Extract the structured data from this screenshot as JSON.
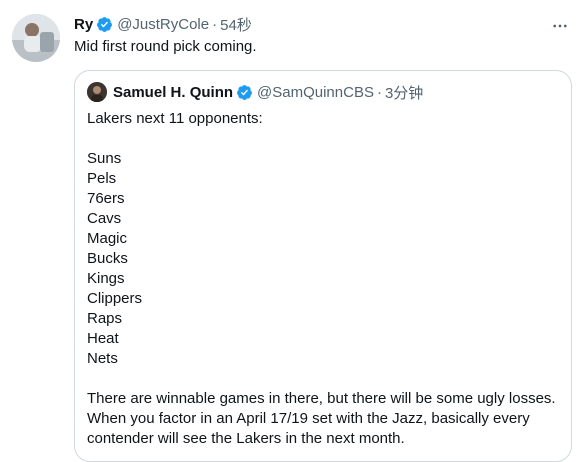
{
  "tweet": {
    "author_name": "Ry",
    "author_handle": "@JustRyCole",
    "separator": "·",
    "time": "54秒",
    "text": "Mid first round pick coming."
  },
  "quote": {
    "author_name": "Samuel H. Quinn",
    "author_handle": "@SamQuinnCBS",
    "separator": "·",
    "time": "3分钟",
    "intro": "Lakers next 11 opponents:",
    "teams": [
      "Suns",
      "Pels",
      "76ers",
      "Cavs",
      "Magic",
      "Bucks",
      "Kings",
      "Clippers",
      "Raps",
      "Heat",
      "Nets"
    ],
    "closing": "There are winnable games in there, but there will be some ugly losses. When you factor in an April 17/19 set with the Jazz, basically every contender will see the Lakers in the next month."
  },
  "colors": {
    "verified": "#1d9bf0",
    "secondary_text": "#536471",
    "border": "#cfd9de"
  },
  "icons": {
    "verified": "verified-badge-icon",
    "more": "more-options-icon"
  }
}
